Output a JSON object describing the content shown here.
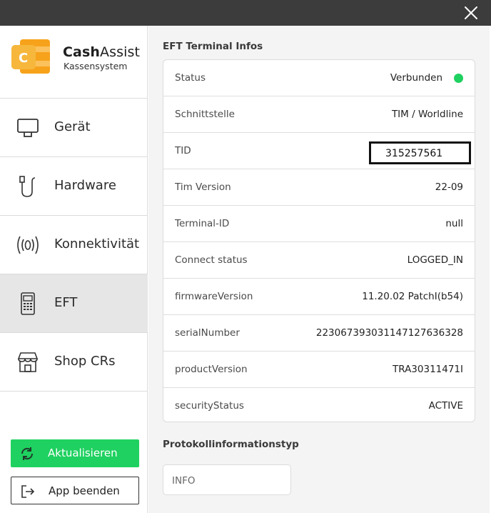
{
  "window": {
    "close_icon": "close-icon"
  },
  "brand": {
    "name_bold": "Cash",
    "name_rest": "Assist",
    "subtitle": "Kassensystem",
    "accent": "#f5a623"
  },
  "sidebar": {
    "items": [
      {
        "label": "Gerät",
        "icon": "monitor-icon"
      },
      {
        "label": "Hardware",
        "icon": "cable-icon"
      },
      {
        "label": "Konnektivität",
        "icon": "wireless-icon"
      },
      {
        "label": "EFT",
        "icon": "card-terminal-icon",
        "active": true
      },
      {
        "label": "Shop CRs",
        "icon": "store-icon"
      }
    ],
    "refresh_label": "Aktualisieren",
    "exit_label": "App beenden"
  },
  "main": {
    "section_title": "EFT Terminal Infos",
    "rows": [
      {
        "key": "Status",
        "value": "Verbunden"
      },
      {
        "key": "Schnittstelle",
        "value": "TIM / Worldline"
      },
      {
        "key": "TID",
        "value": "315257561"
      },
      {
        "key": "Tim Version",
        "value": "22-09"
      },
      {
        "key": "Terminal-ID",
        "value": "null"
      },
      {
        "key": "Connect status",
        "value": "LOGGED_IN"
      },
      {
        "key": "firmwareVersion",
        "value": "11.20.02 PatchI(b54)"
      },
      {
        "key": "serialNumber",
        "value": "22306739303114712763632​8"
      },
      {
        "key": "productVersion",
        "value": "TRA30311471I"
      },
      {
        "key": "securityStatus",
        "value": "ACTIVE"
      }
    ],
    "protocol_title": "Protokollinformationstyp",
    "protocol_value": "INFO"
  },
  "colors": {
    "green": "#1fd160",
    "titlebar": "#3c3c3c",
    "main_bg": "#f4f4f4",
    "active_nav": "#e6e6e6"
  }
}
